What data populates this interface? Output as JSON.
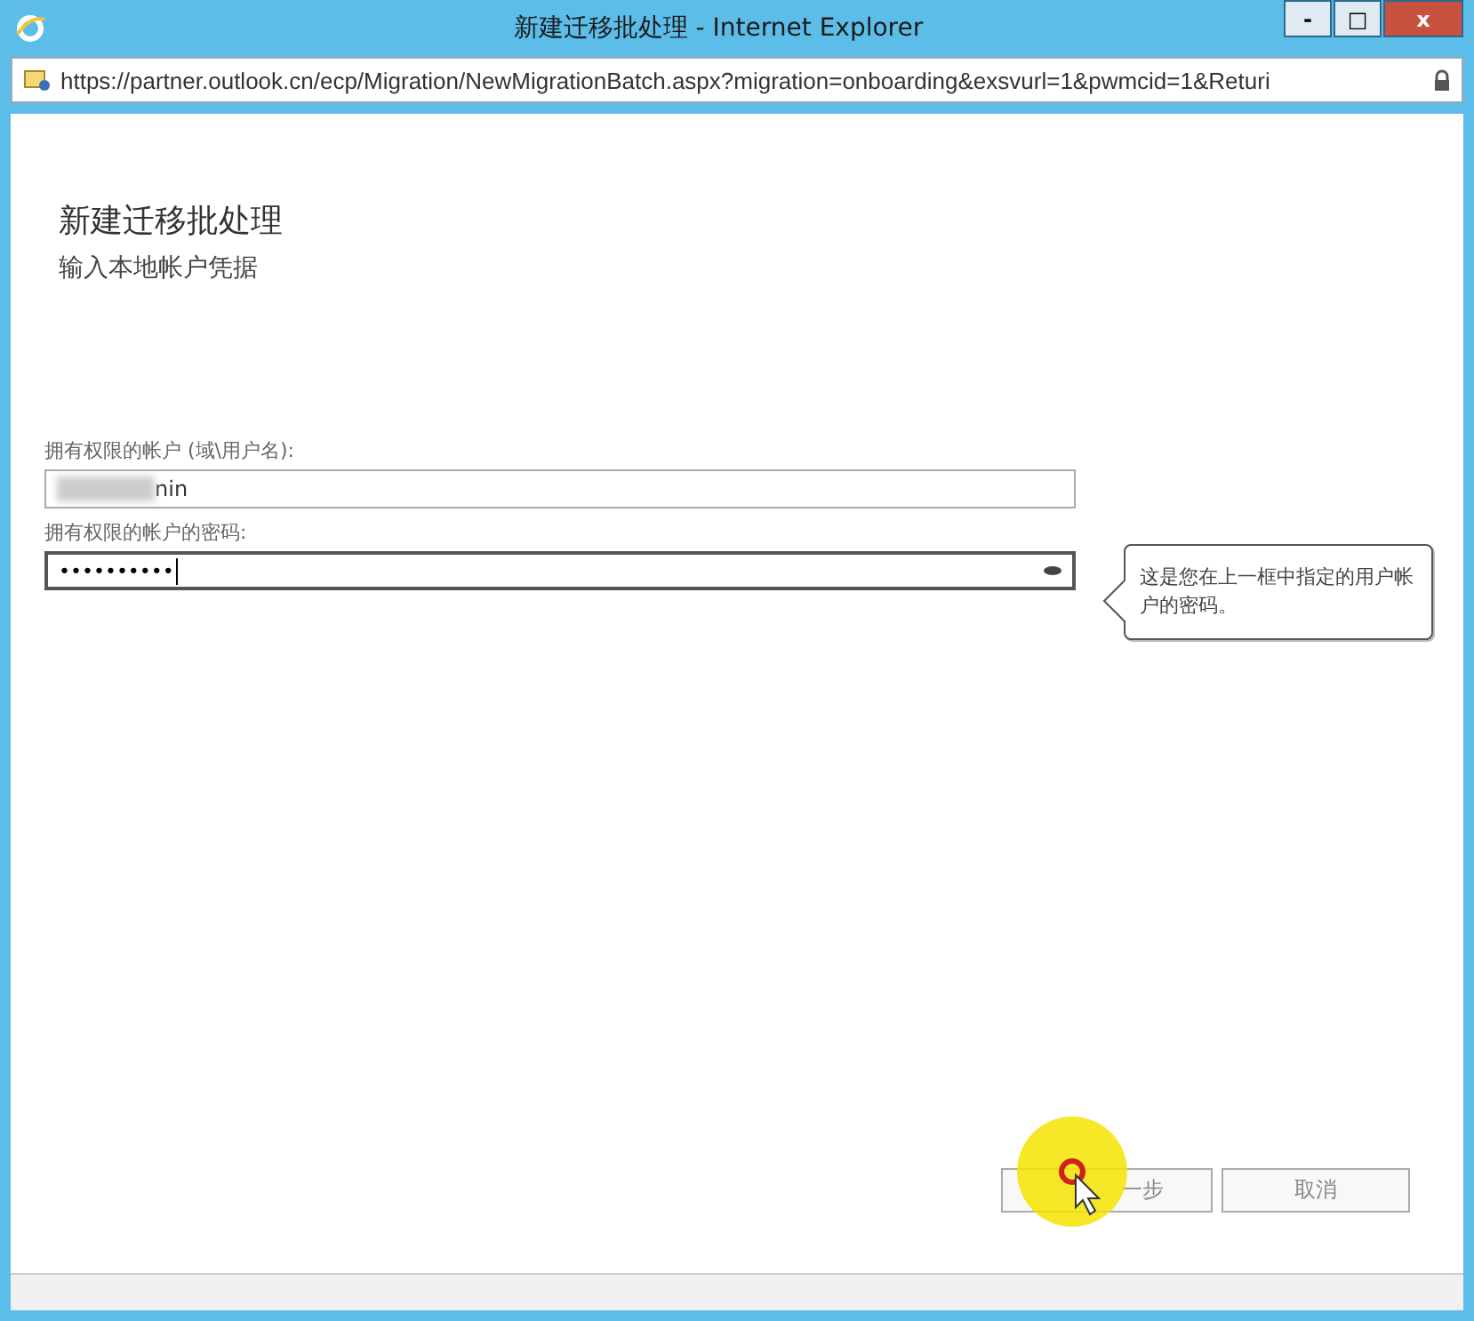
{
  "window": {
    "title": "新建迁移批处理 - Internet Explorer",
    "controls": [
      "-",
      "□",
      "x"
    ]
  },
  "address_bar": {
    "url": "https://partner.outlook.cn/ecp/Migration/NewMigrationBatch.aspx?migration=onboarding&exsvurl=1&pwmcid=1&Returi"
  },
  "page": {
    "title": "新建迁移批处理",
    "subtitle": "输入本地帐户凭据"
  },
  "fields": [
    {
      "label": "拥有权限的帐户 (域\\用户名):",
      "value": "nin",
      "kind": "text",
      "focused": false
    },
    {
      "label": "拥有权限的帐户的密码:",
      "value": "••••••••••",
      "kind": "password",
      "focused": true
    }
  ],
  "tooltip": {
    "text": "这是您在上一框中指定的用户帐户的密码。"
  },
  "buttons": [
    {
      "label": "一步",
      "kind": "next"
    },
    {
      "label": "取消",
      "kind": "cancel"
    }
  ]
}
